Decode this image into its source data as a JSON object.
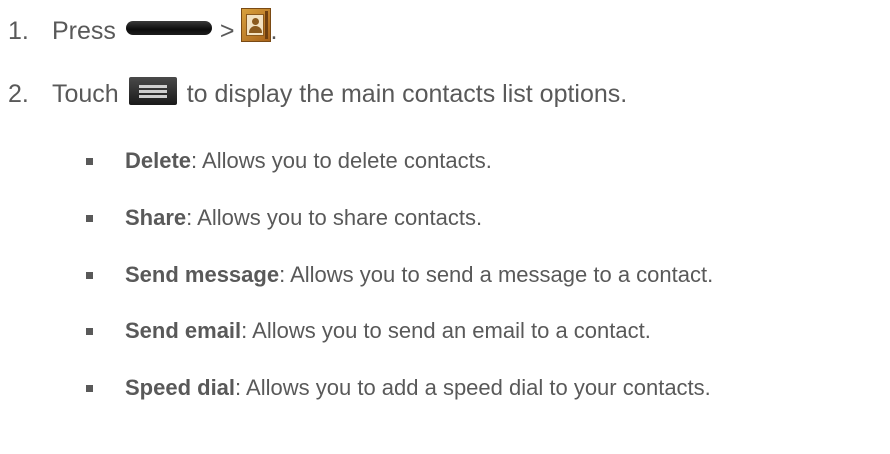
{
  "steps": [
    {
      "number": "1.",
      "text_before": "Press",
      "separator": ">",
      "text_after": ".",
      "icons": [
        "home-key-icon",
        "contacts-app-icon"
      ]
    },
    {
      "number": "2.",
      "text_before": "Touch",
      "text_after": "to display the main contacts list options.",
      "icons": [
        "menu-key-icon"
      ]
    }
  ],
  "options": [
    {
      "term": "Delete",
      "description": ": Allows you to delete contacts."
    },
    {
      "term": "Share",
      "description": ": Allows you to share contacts."
    },
    {
      "term": "Send message",
      "description": ": Allows you to send a message to a contact."
    },
    {
      "term": "Send email",
      "description": ": Allows you to send an email to a contact."
    },
    {
      "term": "Speed dial",
      "description": ": Allows you to add a speed dial to your contacts."
    }
  ],
  "colors": {
    "text": "#595959",
    "background": "#ffffff",
    "contacts_icon": "#c98a2e"
  }
}
